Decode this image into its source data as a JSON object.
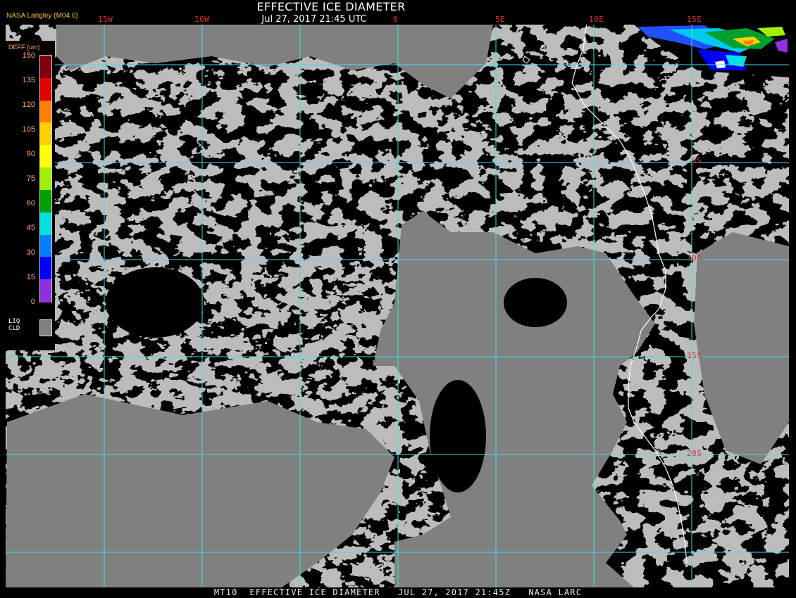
{
  "header": {
    "title": "EFFECTIVE ICE DIAMETER",
    "subtitle": "Jul 27, 2017 21:45 UTC",
    "producer": "NASA Langley (M04.0)"
  },
  "footer": {
    "caption": "MT10  EFFECTIVE ICE DIAMETER   JUL 27, 2017 21:45Z   NASA LARC"
  },
  "map": {
    "longitude_labels": [
      "15W",
      "10W",
      "0",
      "5E",
      "10E",
      "15E"
    ],
    "latitude_labels": [
      "5S",
      "10S",
      "15S",
      "20S"
    ],
    "colors": {
      "grid": "#40e0e8",
      "label": "#e03030",
      "liquid_cloud": "#808080",
      "coastline": "#ffffff",
      "background": "#000000"
    }
  },
  "legend": {
    "unit": "DEFF (um)",
    "ticks": [
      "150",
      "135",
      "120",
      "105",
      "90",
      "75",
      "60",
      "45",
      "30",
      "15",
      "0"
    ],
    "colors": [
      "#800010",
      "#e00000",
      "#ff7f00",
      "#ffd000",
      "#ffff00",
      "#a0f000",
      "#00a000",
      "#00e0e0",
      "#0080ff",
      "#0000ff",
      "#9030e0"
    ],
    "liquid_cloud_label": [
      "LIQ",
      "CLD"
    ]
  }
}
